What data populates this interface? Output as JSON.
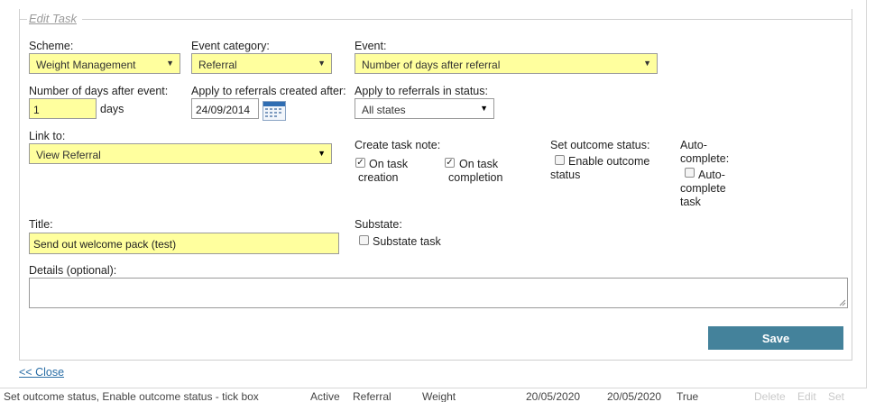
{
  "legend": "Edit Task",
  "scheme": {
    "label": "Scheme:",
    "value": "Weight Management"
  },
  "event_category": {
    "label": "Event category:",
    "value": "Referral"
  },
  "event": {
    "label": "Event:",
    "value": "Number of days after referral"
  },
  "days_after": {
    "label": "Number of days after event:",
    "value": "1",
    "unit": "days"
  },
  "apply_created_after": {
    "label": "Apply to referrals created after:",
    "value": "24/09/2014"
  },
  "apply_status": {
    "label": "Apply to referrals in status:",
    "value": "All states"
  },
  "link_to": {
    "label": "Link to:",
    "value": "View Referral"
  },
  "task_note": {
    "label": "Create task note:",
    "on_creation": {
      "line1": "On task",
      "line2": "creation",
      "checked": true
    },
    "on_completion": {
      "line1": "On task",
      "line2": "completion",
      "checked": true
    }
  },
  "outcome": {
    "label": "Set outcome status:",
    "line1": "Enable outcome",
    "line2": "status",
    "checked": false
  },
  "auto_complete": {
    "label1": "Auto-",
    "label2": "complete:",
    "line1": "Auto-",
    "line2": "complete",
    "line3": "task",
    "checked": false
  },
  "title": {
    "label": "Title:",
    "value": "Send out welcome pack (test)"
  },
  "substate": {
    "label": "Substate:",
    "checkbox_label": "Substate task",
    "checked": false
  },
  "details": {
    "label": "Details (optional):",
    "value": ""
  },
  "save_label": "Save",
  "close_label": "<< Close",
  "background_row": {
    "c1": "Set outcome status, Enable outcome status - tick box",
    "c2": "Active",
    "c3": "Referral",
    "c4": "Weight",
    "c5": "20/05/2020",
    "c6": "20/05/2020",
    "c7": "True",
    "c8": "Delete",
    "c9": "Edit",
    "c10": "Set"
  },
  "colors": {
    "required_field": "#ffff9e",
    "save_button": "#44829b",
    "link": "#2a6ea6"
  }
}
